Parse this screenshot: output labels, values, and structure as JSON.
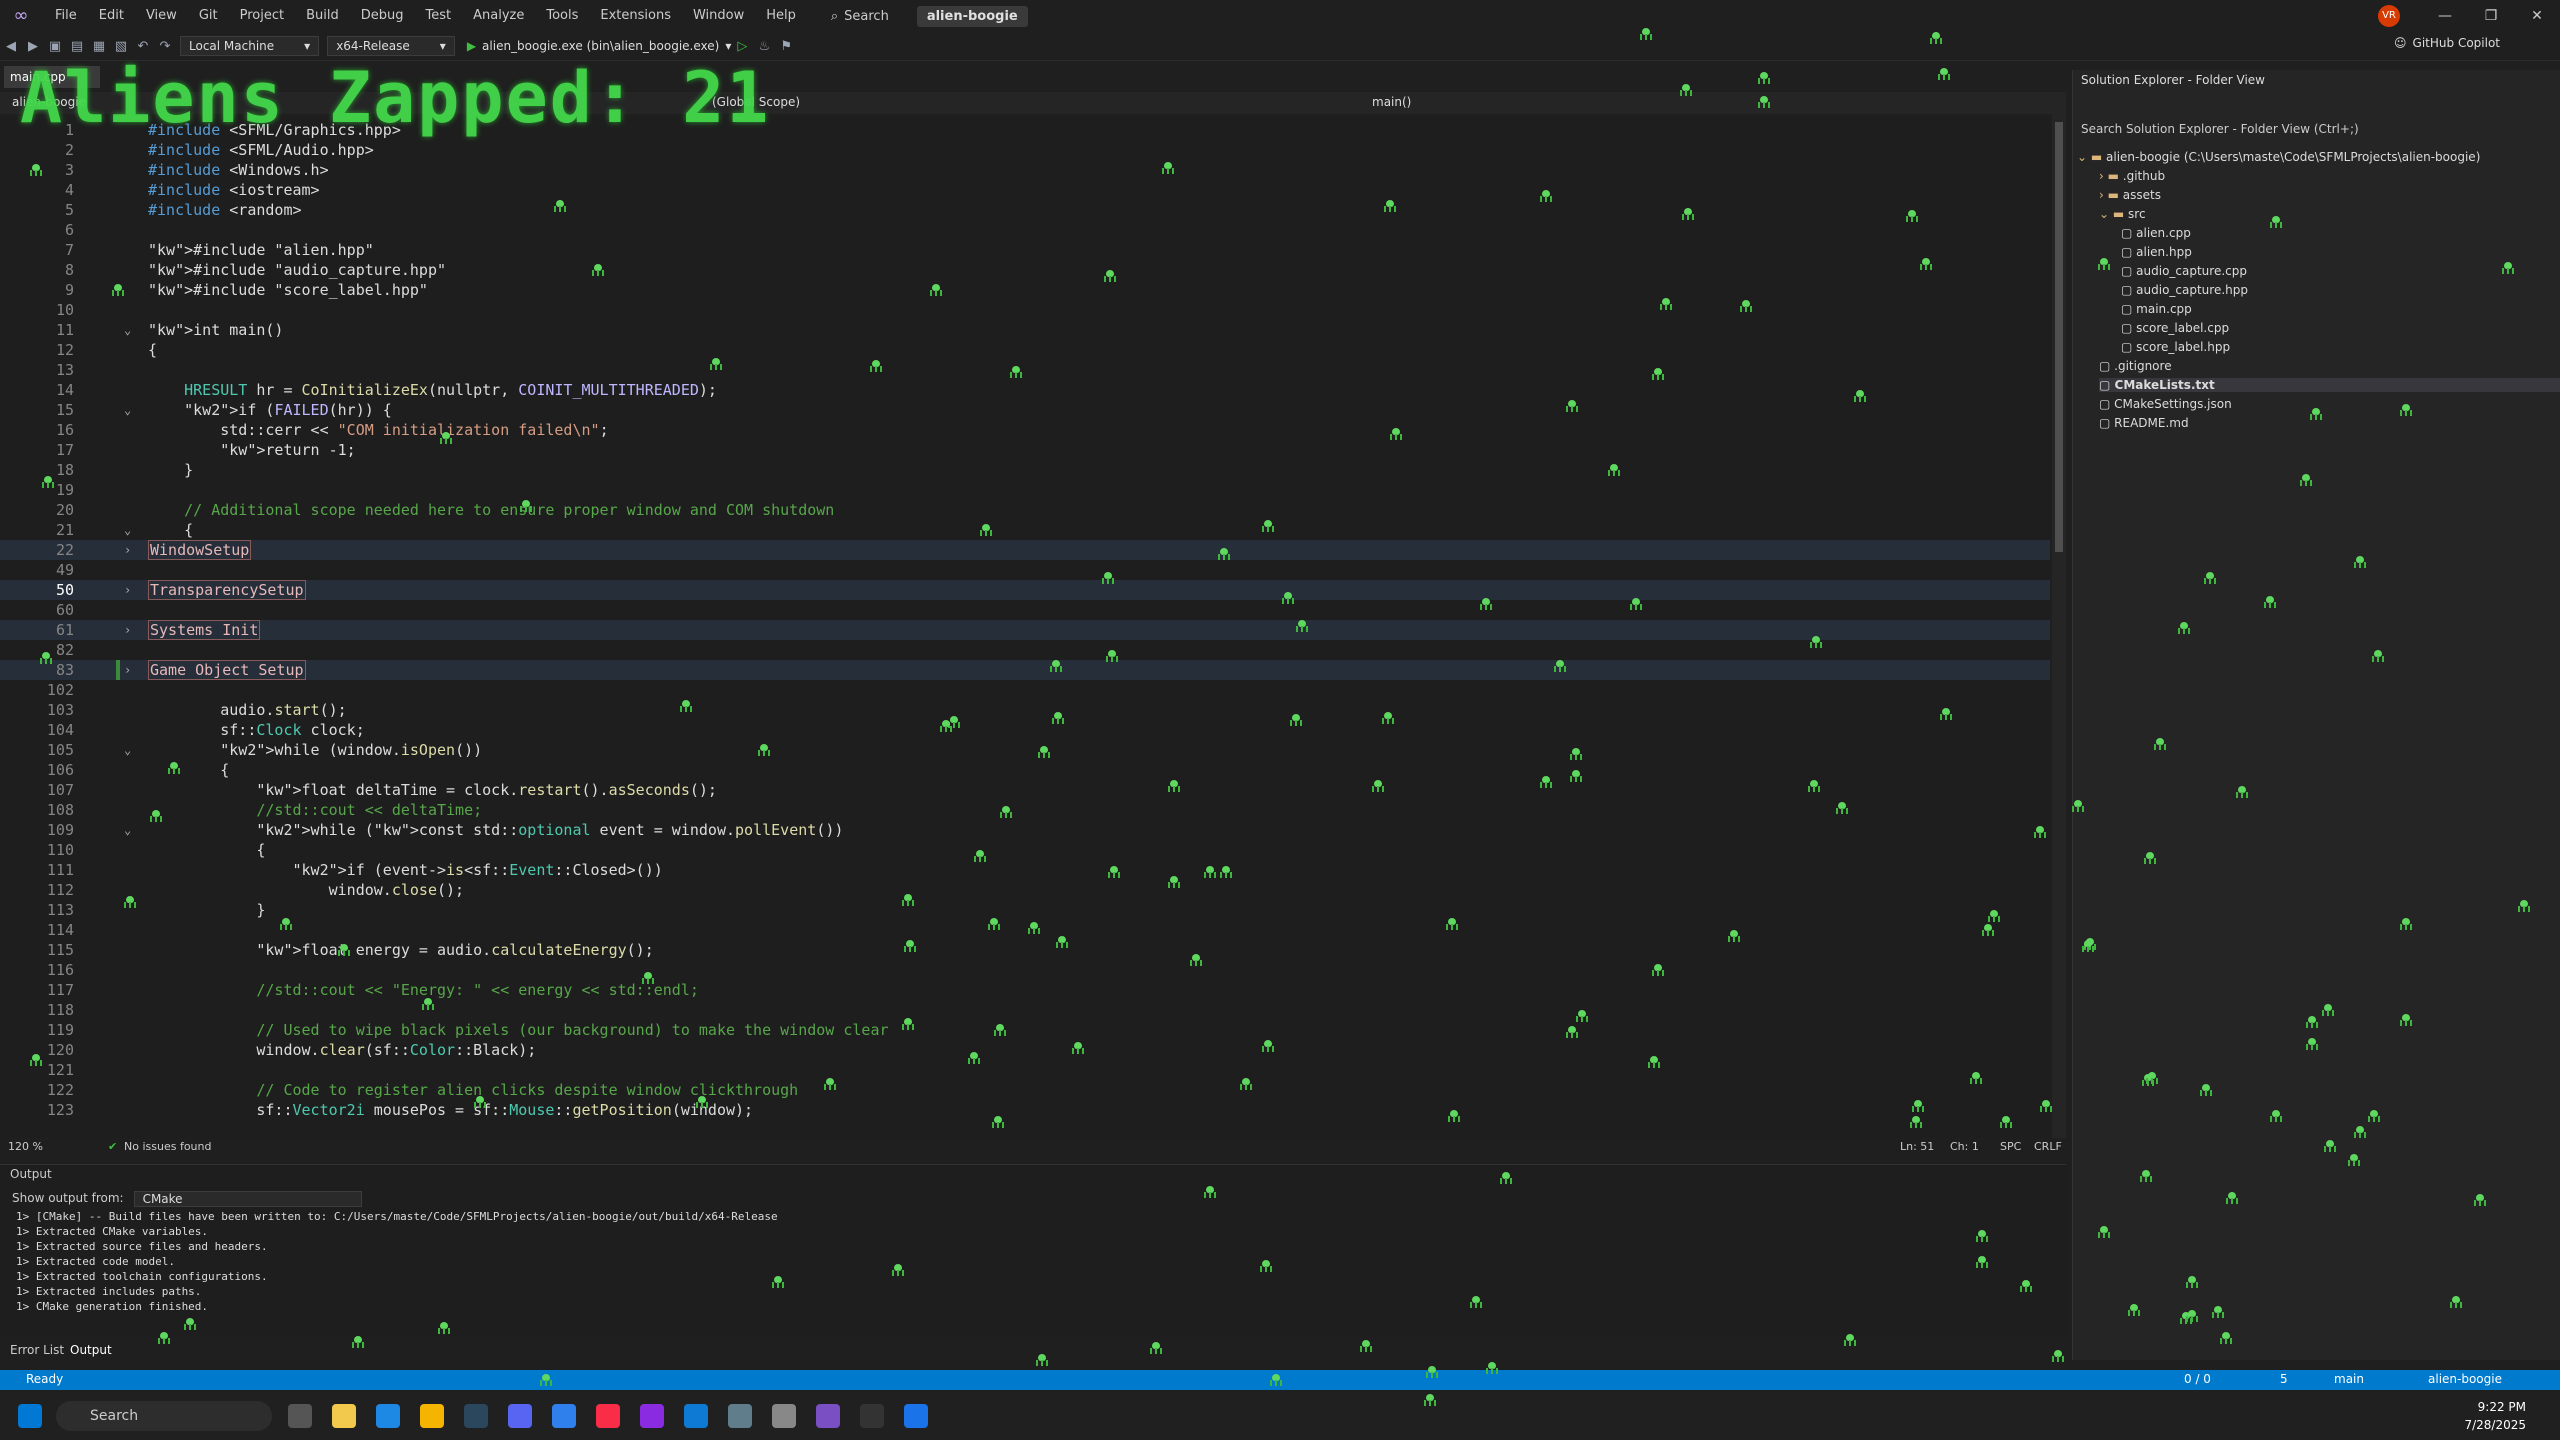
{
  "titlebar": {
    "menus": [
      "File",
      "Edit",
      "View",
      "Git",
      "Project",
      "Build",
      "Debug",
      "Test",
      "Analyze",
      "Tools",
      "Extensions",
      "Window",
      "Help"
    ],
    "search_label": "Search",
    "solution_name": "alien-boogie",
    "avatar_initials": "VR"
  },
  "toolbar": {
    "target": "Local Machine",
    "config": "x64-Release",
    "run_target": "alien_boogie.exe (bin\\alien_boogie.exe)",
    "copilot": "GitHub Copilot"
  },
  "overlay": {
    "score_text": "Aliens Zapped: 21"
  },
  "editor": {
    "active_tab": "main.cpp",
    "nav_left": "alien-boogie",
    "nav_mid": "(Global Scope)",
    "nav_right": "main()",
    "zoom": "120 %",
    "issues": "No issues found",
    "position": "Ln: 51",
    "column": "Ch: 1",
    "encoding": "SPC",
    "line_ending": "CRLF"
  },
  "code_lines": [
    {
      "n": "1",
      "t": "#include <SFML/Graphics.hpp>"
    },
    {
      "n": "2",
      "t": "#include <SFML/Audio.hpp>"
    },
    {
      "n": "3",
      "t": "#include <Windows.h>"
    },
    {
      "n": "4",
      "t": "#include <iostream>"
    },
    {
      "n": "5",
      "t": "#include <random>"
    },
    {
      "n": "6",
      "t": ""
    },
    {
      "n": "7",
      "t": "#include \"alien.hpp\""
    },
    {
      "n": "8",
      "t": "#include \"audio_capture.hpp\""
    },
    {
      "n": "9",
      "t": "#include \"score_label.hpp\""
    },
    {
      "n": "10",
      "t": ""
    },
    {
      "n": "11",
      "t": "int main()"
    },
    {
      "n": "12",
      "t": "{"
    },
    {
      "n": "13",
      "t": ""
    },
    {
      "n": "14",
      "t": "    HRESULT hr = CoInitializeEx(nullptr, COINIT_MULTITHREADED);"
    },
    {
      "n": "15",
      "t": "    if (FAILED(hr)) {"
    },
    {
      "n": "16",
      "t": "        std::cerr << \"COM initialization failed\\n\";"
    },
    {
      "n": "17",
      "t": "        return -1;"
    },
    {
      "n": "18",
      "t": "    }"
    },
    {
      "n": "19",
      "t": ""
    },
    {
      "n": "20",
      "t": "    // Additional scope needed here to ensure proper window and COM shutdown"
    },
    {
      "n": "21",
      "t": "    {"
    },
    {
      "n": "22",
      "t": "WindowSetup"
    },
    {
      "n": "49",
      "t": ""
    },
    {
      "n": "50",
      "t": "TransparencySetup"
    },
    {
      "n": "60",
      "t": ""
    },
    {
      "n": "61",
      "t": "Systems Init"
    },
    {
      "n": "82",
      "t": ""
    },
    {
      "n": "83",
      "t": "Game Object Setup"
    },
    {
      "n": "102",
      "t": ""
    },
    {
      "n": "103",
      "t": "        audio.start();"
    },
    {
      "n": "104",
      "t": "        sf::Clock clock;"
    },
    {
      "n": "105",
      "t": "        while (window.isOpen())"
    },
    {
      "n": "106",
      "t": "        {"
    },
    {
      "n": "107",
      "t": "            float deltaTime = clock.restart().asSeconds();"
    },
    {
      "n": "108",
      "t": "            //std::cout << deltaTime;"
    },
    {
      "n": "109",
      "t": "            while (const std::optional event = window.pollEvent())"
    },
    {
      "n": "110",
      "t": "            {"
    },
    {
      "n": "111",
      "t": "                if (event->is<sf::Event::Closed>())"
    },
    {
      "n": "112",
      "t": "                    window.close();"
    },
    {
      "n": "113",
      "t": "            }"
    },
    {
      "n": "114",
      "t": ""
    },
    {
      "n": "115",
      "t": "            float energy = audio.calculateEnergy();"
    },
    {
      "n": "116",
      "t": ""
    },
    {
      "n": "117",
      "t": "            //std::cout << \"Energy: \" << energy << std::endl;"
    },
    {
      "n": "118",
      "t": ""
    },
    {
      "n": "119",
      "t": "            // Used to wipe black pixels (our background) to make the window clear"
    },
    {
      "n": "120",
      "t": "            window.clear(sf::Color::Black);"
    },
    {
      "n": "121",
      "t": ""
    },
    {
      "n": "122",
      "t": "            // Code to register alien clicks despite window clickthrough"
    },
    {
      "n": "123",
      "t": "            sf::Vector2i mousePos = sf::Mouse::getPosition(window);"
    }
  ],
  "output": {
    "title": "Output",
    "show_from_label": "Show output from:",
    "source": "CMake",
    "lines": [
      "1> [CMake] -- Build files have been written to: C:/Users/maste/Code/SFMLProjects/alien-boogie/out/build/x64-Release",
      "1> Extracted CMake variables.",
      "1> Extracted source files and headers.",
      "1> Extracted code model.",
      "1> Extracted toolchain configurations.",
      "1> Extracted includes paths.",
      "1> CMake generation finished."
    ],
    "tabs": [
      "Error List",
      "Output"
    ]
  },
  "solution_explorer": {
    "title": "Solution Explorer - Folder View",
    "search_placeholder": "Search Solution Explorer - Folder View (Ctrl+;)",
    "items": [
      {
        "label": "alien-boogie (C:\\Users\\maste\\Code\\SFMLProjects\\alien-boogie)",
        "level": 0,
        "type": "folder",
        "expanded": true
      },
      {
        "label": ".github",
        "level": 1,
        "type": "folder"
      },
      {
        "label": "assets",
        "level": 1,
        "type": "folder"
      },
      {
        "label": "src",
        "level": 1,
        "type": "folder",
        "expanded": true
      },
      {
        "label": "alien.cpp",
        "level": 2,
        "type": "file"
      },
      {
        "label": "alien.hpp",
        "level": 2,
        "type": "file"
      },
      {
        "label": "audio_capture.cpp",
        "level": 2,
        "type": "file"
      },
      {
        "label": "audio_capture.hpp",
        "level": 2,
        "type": "file"
      },
      {
        "label": "main.cpp",
        "level": 2,
        "type": "file"
      },
      {
        "label": "score_label.cpp",
        "level": 2,
        "type": "file"
      },
      {
        "label": "score_label.hpp",
        "level": 2,
        "type": "file"
      },
      {
        "label": ".gitignore",
        "level": 1,
        "type": "file"
      },
      {
        "label": "CMakeLists.txt",
        "level": 1,
        "type": "file",
        "selected": true
      },
      {
        "label": "CMakeSettings.json",
        "level": 1,
        "type": "file"
      },
      {
        "label": "README.md",
        "level": 1,
        "type": "file"
      }
    ]
  },
  "statusbar": {
    "ready": "Ready",
    "sync": "0 / 0",
    "changes": "5",
    "branch": "main",
    "repo": "alien-boogie"
  },
  "taskbar": {
    "search": "Search",
    "time": "9:22 PM",
    "date": "7/28/2025"
  },
  "colors": {
    "accent": "#007acc",
    "alien": "#5fd85f",
    "score": "#43d94b"
  }
}
